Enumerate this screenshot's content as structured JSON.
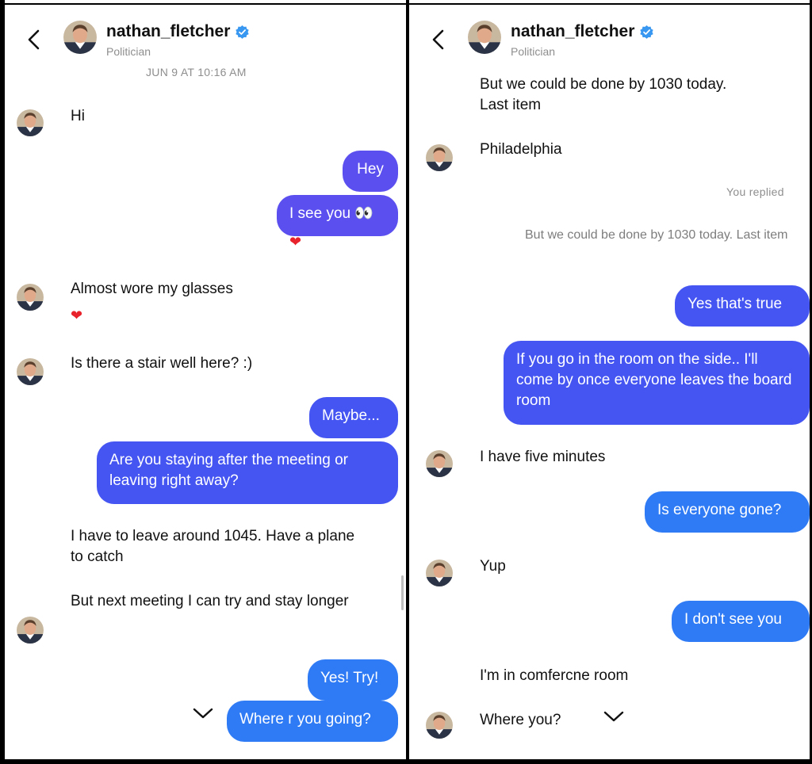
{
  "header": {
    "name": "nathan_fletcher",
    "subtitle": "Politician"
  },
  "colors": {
    "bubble_purple": "#5b4ff0",
    "bubble_indigo": "#4555f2",
    "bubble_blue": "#2f7bf5",
    "verified": "#3897f0",
    "heart": "#e8232c"
  },
  "icons": [
    "back-chevron-icon",
    "verified-badge-icon",
    "chevron-down-icon",
    "avatar-photo"
  ],
  "left": {
    "timestamp": "JUN 9 AT 10:16 AM",
    "messages": [
      {
        "text": "Hi"
      },
      {
        "text": "Hey"
      },
      {
        "text": "I see you 👀",
        "reaction": "❤"
      },
      {
        "text": "Almost wore my glasses",
        "reaction": "❤"
      },
      {
        "text": "Is there a stair well here? :)"
      },
      {
        "text": "Maybe..."
      },
      {
        "text": "Are you staying after the meeting or leaving right away?"
      },
      {
        "text": "I have to leave around 1045. Have a plane to catch"
      },
      {
        "text": "But next meeting I can try and stay longer"
      },
      {
        "text": "Yes! Try!"
      },
      {
        "text": "Where r you going?"
      }
    ]
  },
  "right": {
    "messages": [
      {
        "text": "But we could be done by 1030 today. Last item"
      },
      {
        "text": "Philadelphia"
      },
      {
        "text": "You replied"
      },
      {
        "text": "But we could be done by 1030 today. Last item"
      },
      {
        "text": "Yes that's true"
      },
      {
        "text": "If you go in the room on the side.. I'll come by once everyone leaves the board room"
      },
      {
        "text": "I have five minutes"
      },
      {
        "text": "Is everyone gone?"
      },
      {
        "text": "Yup"
      },
      {
        "text": "I don't see you"
      },
      {
        "text": "I'm in comfercne room"
      },
      {
        "text": "Where you?"
      }
    ]
  }
}
